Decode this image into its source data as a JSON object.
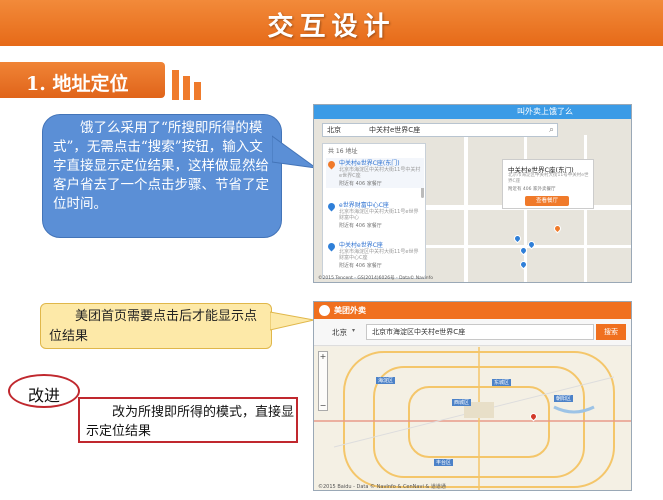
{
  "title": "交互设计",
  "section": {
    "label": "1. 地址定位"
  },
  "callouts": {
    "blue": "饿了么采用了“所搜即所得的模式”，无需点击“搜索”按钮，输入文字直接显示定位结果，这样做显然给客户省去了一个点击步骤、节省了定位时间。",
    "yellow": "美团首页需要点击后才能显示点位结果",
    "improve_label": "改进",
    "improve_text": "改为所搜即所得的模式，直接显示定位结果"
  },
  "screenshot1": {
    "header_title": "叫外卖上饿了么",
    "city": "北京",
    "query": "中关村e世界C座",
    "result_count": "共 16 地址",
    "results": [
      {
        "name": "中关村e世界C座(东门)",
        "addr": "北京市海淀区中关村大街11号中关村e世界C座",
        "meta": "附近有 406 家餐厅"
      },
      {
        "name": "e世界财富中心C座",
        "addr": "北京市海淀区中关村大街11号e世界财富中心",
        "meta": "附近有 406 家餐厅"
      },
      {
        "name": "中关村e世界C座",
        "addr": "北京市海淀区中关村大街11号e世界财富中心C座",
        "meta": "附近有 406 家餐厅"
      }
    ],
    "popup": {
      "name": "中关村e世界C座(东门)",
      "addr": "北京市海淀区中关村大街11号中关村e世界C座",
      "meta": "附近有 406 家外卖餐厅",
      "button": "查看餐厅"
    },
    "copyright": "©2015 Tencent - GS(2014)6026号 - Data© Navinfo",
    "colors": {
      "header": "#3b9be6",
      "pin_active": "#f07a2a",
      "pin": "#2f7fd8"
    }
  },
  "screenshot2": {
    "brand": "美团外卖",
    "city": "北京",
    "query": "北京市海淀区中关村e世界C座",
    "search_button": "搜索",
    "map_labels": [
      "西城区",
      "东城区",
      "朝阳区",
      "海淀区",
      "丰台区"
    ],
    "footer": "©2015 Baidu - Data © NavInfo & CenNavi & 道道通",
    "colors": {
      "header": "#f0701f",
      "button": "#f0701f"
    }
  }
}
